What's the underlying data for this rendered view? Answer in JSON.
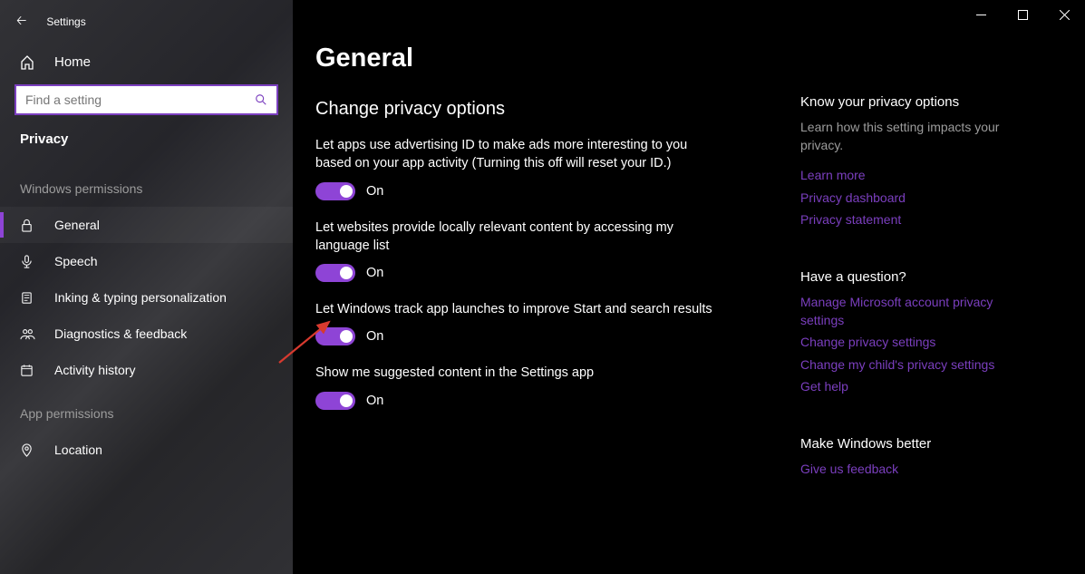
{
  "app": {
    "name": "Settings"
  },
  "window": {
    "minimize": "─",
    "maximize": "☐",
    "close": "✕"
  },
  "sidebar": {
    "home_label": "Home",
    "search_placeholder": "Find a setting",
    "category": "Privacy",
    "sections": [
      {
        "title": "Windows permissions",
        "items": [
          {
            "icon": "lock-icon",
            "label": "General",
            "active": true
          },
          {
            "icon": "speech-icon",
            "label": "Speech",
            "active": false
          },
          {
            "icon": "inking-icon",
            "label": "Inking & typing personalization",
            "active": false
          },
          {
            "icon": "diagnostics-icon",
            "label": "Diagnostics & feedback",
            "active": false
          },
          {
            "icon": "activity-icon",
            "label": "Activity history",
            "active": false
          }
        ]
      },
      {
        "title": "App permissions",
        "items": [
          {
            "icon": "location-icon",
            "label": "Location",
            "active": false
          }
        ]
      }
    ]
  },
  "page": {
    "title": "General",
    "subhead": "Change privacy options",
    "options": [
      {
        "desc": "Let apps use advertising ID to make ads more interesting to you based on your app activity (Turning this off will reset your ID.)",
        "state": "On"
      },
      {
        "desc": "Let websites provide locally relevant content by accessing my language list",
        "state": "On"
      },
      {
        "desc": "Let Windows track app launches to improve Start and search results",
        "state": "On"
      },
      {
        "desc": "Show me suggested content in the Settings app",
        "state": "On"
      }
    ]
  },
  "right": {
    "block1": {
      "heading": "Know your privacy options",
      "text": "Learn how this setting impacts your privacy.",
      "links": [
        "Learn more",
        "Privacy dashboard",
        "Privacy statement"
      ]
    },
    "block2": {
      "heading": "Have a question?",
      "links": [
        "Manage Microsoft account privacy settings",
        "Change privacy settings",
        "Change my child's privacy settings",
        "Get help"
      ]
    },
    "block3": {
      "heading": "Make Windows better",
      "links": [
        "Give us feedback"
      ]
    }
  },
  "icons": {
    "home": "⌂",
    "search": "⌕",
    "lock": "🔒",
    "speech": "🎤",
    "inking": "📋",
    "diagnostics": "👥",
    "activity": "🗓",
    "location": "📍"
  },
  "colors": {
    "accent": "#8e44d6",
    "link": "#7b3fbf"
  }
}
